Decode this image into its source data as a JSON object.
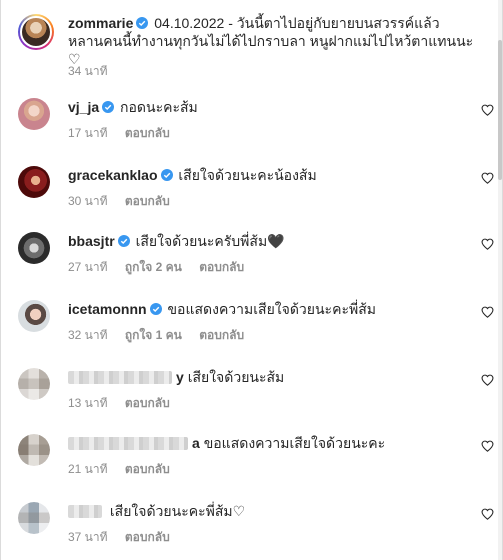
{
  "caption": {
    "username": "zommarie",
    "date": "04.10.2022",
    "text": "- วันนี้ตาไปอยู่กับยายบนสวรรค์แล้ว หลานคนนี้ทำงานทุกวันไม่ได้ไปกราบลา หนูฝากแม่ไปไหว้ตาแทนนะ ♡",
    "time": "34 นาที"
  },
  "comments": [
    {
      "username": "vj_ja",
      "verified": true,
      "text": "กอดนะคะส้ม",
      "time": "17 นาที",
      "likes": "",
      "reply": "ตอบกลับ"
    },
    {
      "username": "gracekanklao",
      "verified": true,
      "text": "เสียใจด้วยนะคะน้องส้ม",
      "time": "30 นาที",
      "likes": "",
      "reply": "ตอบกลับ"
    },
    {
      "username": "bbasjtr",
      "verified": true,
      "text": "เสียใจด้วยนะครับพี่ส้ม🖤",
      "time": "27 นาที",
      "likes": "ถูกใจ 2 คน",
      "reply": "ตอบกลับ"
    },
    {
      "username": "icetamonnn",
      "verified": true,
      "text": "ขอแสดงความเสียใจด้วยนะคะพี่ส้ม",
      "time": "32 นาที",
      "likes": "ถูกใจ 1 คน",
      "reply": "ตอบกลับ"
    },
    {
      "username": "y",
      "verified": false,
      "text": "เสียใจด้วยนะส้ม",
      "time": "13 นาที",
      "likes": "",
      "reply": "ตอบกลับ"
    },
    {
      "username": "a",
      "verified": false,
      "text": "ขอแสดงความเสียใจด้วยนะคะ",
      "time": "21 นาที",
      "likes": "",
      "reply": "ตอบกลับ"
    },
    {
      "username": "",
      "verified": false,
      "text": "เสียใจด้วยนะคะพี่ส้ม♡",
      "time": "37 นาที",
      "likes": "",
      "reply": "ตอบกลับ"
    }
  ],
  "icons": {
    "verified": "verified-badge-icon",
    "like": "heart-outline-icon"
  },
  "colors": {
    "verified": "#3897f0",
    "muted": "#8e8e8e",
    "text": "#262626"
  }
}
